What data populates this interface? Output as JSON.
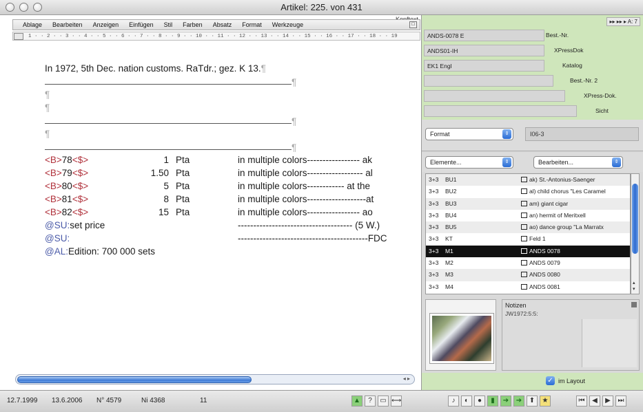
{
  "window": {
    "title": "Artikel: 225. von 431"
  },
  "editor": {
    "header_label": "Kopftext",
    "menu": [
      "Ablage",
      "Bearbeiten",
      "Anzeigen",
      "Einfügen",
      "Stil",
      "Farben",
      "Absatz",
      "Format",
      "Werkzeuge"
    ],
    "ruler": "1 · · 2 · · 3 · · 4 · · 5 · · 6 · · 7 · · 8 · · 9 · · 10 · · 11 · · 12 · · 13 · · 14 · · 15 · · 16 · · 17 · · 18 · · 19",
    "first_line": "In 1972, 5th Dec. nation customs. RaTdr.; gez. K 13.",
    "pilcrow": "¶",
    "price_rows": [
      {
        "tag_open": "<B>",
        "code": "78",
        "tag_close": "<$>",
        "value": "1",
        "currency": "Pta",
        "desc": "in multiple colors----------------- ak"
      },
      {
        "tag_open": "<B>",
        "code": "79",
        "tag_close": "<$>",
        "value": "1.50",
        "currency": "Pta",
        "desc": "in multiple colors------------------ al"
      },
      {
        "tag_open": "<B>",
        "code": "80",
        "tag_close": "<$>",
        "value": "5",
        "currency": "Pta",
        "desc": "in multiple colors------------ at the"
      },
      {
        "tag_open": "<B>",
        "code": "81",
        "tag_close": "<$>",
        "value": "8",
        "currency": "Pta",
        "desc": "in multiple colors-------------------at"
      },
      {
        "tag_open": "<B>",
        "code": "82",
        "tag_close": "<$>",
        "value": "15",
        "currency": "Pta",
        "desc": "in multiple colors----------------- ao"
      }
    ],
    "su_price_label": "@SU:",
    "su_price_text": "set price",
    "su_price_desc": "------------------------------------- (5 W.)",
    "su_fdc_label": "@SU:",
    "su_fdc_desc": "------------------------------------------FDC",
    "al_label": "@AL:",
    "al_text": "Edition: 700 000 sets"
  },
  "status": {
    "date1": "12.7.1999",
    "date2": "13.6.2006",
    "number1": "N° 4579",
    "number2": "Ni 4368",
    "count": "11"
  },
  "right": {
    "nav": "▸▸ ▸▸ ▸ A: 7",
    "tabs": [
      {
        "field": "ANDS-0078 E",
        "label": "Best.-Nr."
      },
      {
        "field": "ANDS01-IH",
        "label": "XPressDok"
      },
      {
        "field": "EK1 Engl",
        "label": "Katalog"
      },
      {
        "field": "",
        "label": "Best.-Nr. 2"
      },
      {
        "field": "",
        "label": "XPress-Dok."
      },
      {
        "field": "",
        "label": "Sicht"
      }
    ],
    "format_select": "Format",
    "format_value": "I06-3",
    "elements_select": "Elemente...",
    "edit_select": "Bearbeiten...",
    "list": [
      {
        "c1": "3+3",
        "c2": "BU1",
        "c3": "ak) St.-Antonius-Saenger",
        "selected": false
      },
      {
        "c1": "3+3",
        "c2": "BU2",
        "c3": "al) child chorus \"Les Caramel",
        "selected": false
      },
      {
        "c1": "3+3",
        "c2": "BU3",
        "c3": "am) giant cigar",
        "selected": false
      },
      {
        "c1": "3+3",
        "c2": "BU4",
        "c3": "an) hermit of Meritxell",
        "selected": false
      },
      {
        "c1": "3+3",
        "c2": "BU5",
        "c3": "ao) dance group \"La Marratx",
        "selected": false
      },
      {
        "c1": "3+3",
        "c2": "KT",
        "c3": "Feld 1",
        "selected": false
      },
      {
        "c1": "3+3",
        "c2": "M1",
        "c3": "ANDS 0078",
        "selected": true
      },
      {
        "c1": "3+3",
        "c2": "M2",
        "c3": "ANDS 0079",
        "selected": false
      },
      {
        "c1": "3+3",
        "c2": "M3",
        "c3": "ANDS 0080",
        "selected": false
      },
      {
        "c1": "3+3",
        "c2": "M4",
        "c3": "ANDS 0081",
        "selected": false
      }
    ],
    "notes_label": "Notizen",
    "notes_text": "JW1972:5:5:",
    "layout_label": "im Layout"
  }
}
